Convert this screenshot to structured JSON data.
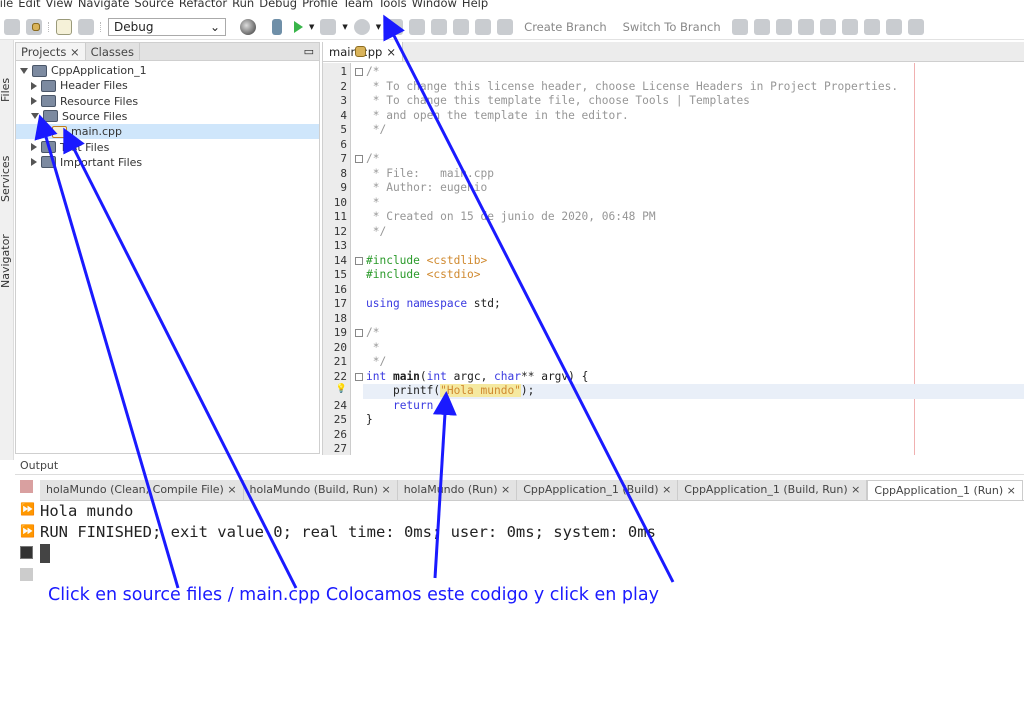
{
  "menu": [
    "File",
    "Edit",
    "View",
    "Navigate",
    "Source",
    "Refactor",
    "Run",
    "Debug",
    "Profile",
    "Team",
    "Tools",
    "Window",
    "Help"
  ],
  "toolbar": {
    "configuration": "Debug",
    "create_branch": "Create Branch",
    "switch_branch": "Switch To Branch",
    "run_icon": "play-icon",
    "run_color": "#39b54a"
  },
  "side_tabs": [
    "Files",
    "Services",
    "Navigator"
  ],
  "projects": {
    "tabs": [
      "Projects",
      "Classes"
    ],
    "tree": [
      {
        "label": "CppApplication_1",
        "level": 0,
        "open": true
      },
      {
        "label": "Header Files",
        "level": 1,
        "open": false
      },
      {
        "label": "Resource Files",
        "level": 1,
        "open": false
      },
      {
        "label": "Source Files",
        "level": 1,
        "open": true
      },
      {
        "label": "main.cpp",
        "level": 2,
        "selected": true
      },
      {
        "label": "Test Files",
        "level": 1,
        "open": false
      },
      {
        "label": "Important Files",
        "level": 1,
        "open": false
      }
    ]
  },
  "editor": {
    "tab": "main.cpp",
    "lines": [
      "/*",
      " * To change this license header, choose License Headers in Project Properties.",
      " * To change this template file, choose Tools | Templates",
      " * and open the template in the editor.",
      " */",
      "",
      "/*",
      " * File:   main.cpp",
      " * Author: eugenio",
      " *",
      " * Created on 15 de junio de 2020, 06:48 PM",
      " */",
      "",
      "#include <cstdlib>",
      "#include <cstdio>",
      "",
      "using namespace std;",
      "",
      "/*",
      " *",
      " */",
      "int main(int argc, char** argv) {",
      "    printf(\"Hola mundo\");",
      "    return 0;",
      "}",
      "",
      ""
    ]
  },
  "output": {
    "title": "Output",
    "tabs": [
      "holaMundo (Clean, Compile File)",
      "holaMundo (Build, Run)",
      "holaMundo (Run)",
      "CppApplication_1 (Build)",
      "CppApplication_1 (Build, Run)",
      "CppApplication_1 (Run)"
    ],
    "lines": [
      "Hola mundo",
      "RUN FINISHED; exit value 0; real time: 0ms; user: 0ms; system: 0ms"
    ]
  },
  "annotation": {
    "caption": "Click en source files / main.cpp Colocamos este codigo y click en play",
    "color": "#1a1aff"
  }
}
